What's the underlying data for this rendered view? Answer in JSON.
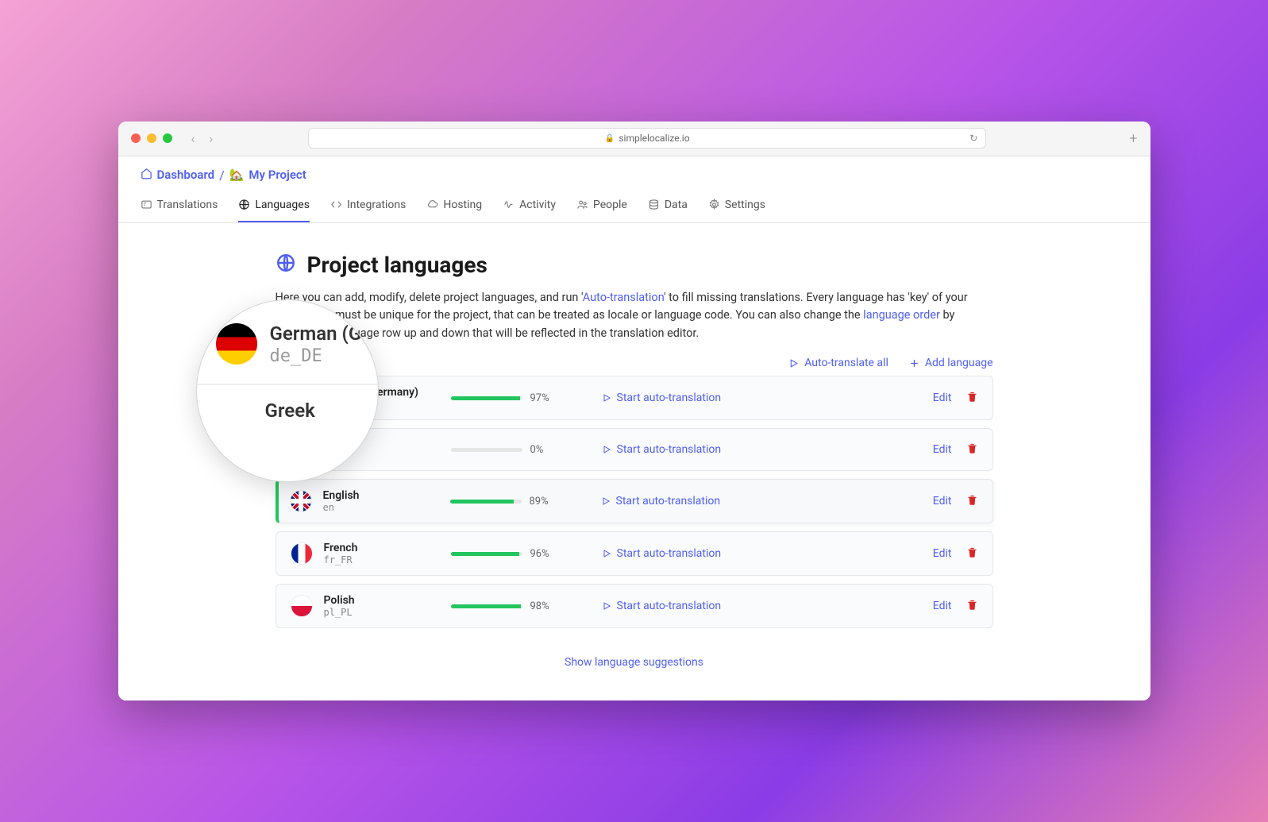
{
  "browser": {
    "url_host": "simplelocalize.io"
  },
  "breadcrumb": {
    "dashboard": "Dashboard",
    "separator": "/",
    "project_emoji": "🏡",
    "project_name": "My Project"
  },
  "tabs": [
    {
      "label": "Translations"
    },
    {
      "label": "Languages"
    },
    {
      "label": "Integrations"
    },
    {
      "label": "Hosting"
    },
    {
      "label": "Activity"
    },
    {
      "label": "People"
    },
    {
      "label": "Data"
    },
    {
      "label": "Settings"
    }
  ],
  "page": {
    "title": "Project languages",
    "desc_1": "Here you can add, modify, delete project languages, and run '",
    "link_auto": "Auto-translation",
    "desc_2": "' to fill missing translations. Every language has 'key' of your choice that must be unique for the project, that can be treated as locale or language code. You can also change the ",
    "link_order": "language order",
    "desc_3": " by dragging a language row up and down that will be reflected in the translation editor."
  },
  "actions": {
    "auto_all": "Auto-translate all",
    "add_lang": "Add language"
  },
  "row_labels": {
    "start_auto": "Start auto-translation",
    "edit": "Edit"
  },
  "languages": [
    {
      "name": "German (Germany)",
      "code": "de_DE",
      "percent": 97,
      "pct_label": "97%",
      "flag": "flag-de"
    },
    {
      "name": "Greek",
      "code": "",
      "percent": 0,
      "pct_label": "0%",
      "flag": ""
    },
    {
      "name": "English",
      "code": "en",
      "percent": 89,
      "pct_label": "89%",
      "flag": "flag-en"
    },
    {
      "name": "French",
      "code": "fr_FR",
      "percent": 96,
      "pct_label": "96%",
      "flag": "flag-fr"
    },
    {
      "name": "Polish",
      "code": "pl_PL",
      "percent": 98,
      "pct_label": "98%",
      "flag": "flag-pl"
    }
  ],
  "magnifier": {
    "name": "German (Ge",
    "code": "de_DE",
    "below": "Greek"
  },
  "suggestions": {
    "label": "Show language suggestions"
  }
}
